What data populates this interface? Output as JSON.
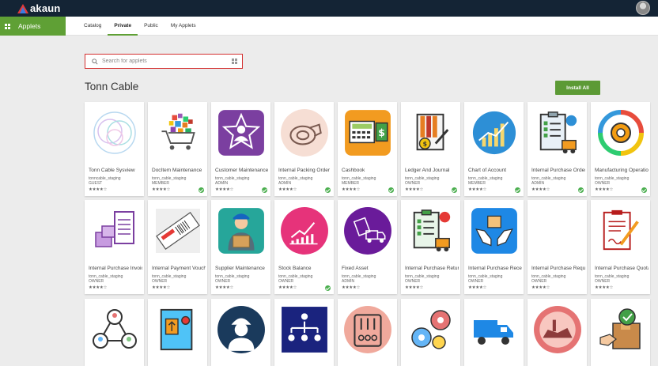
{
  "header": {
    "brand": "akaun"
  },
  "nav": {
    "module": "Applets",
    "tabs": [
      "Catalog",
      "Private",
      "Public",
      "My Applets"
    ],
    "active_tab": "Private"
  },
  "search": {
    "placeholder": "Search for applets"
  },
  "section": {
    "title": "Tonn Cable",
    "install_all": "Install All"
  },
  "colors": {
    "accent": "#5fa035",
    "header": "#142435",
    "search_border": "#d32f2f"
  },
  "apps_row1": [
    {
      "name": "Tonn Cable Sysview",
      "tenant": "tonncable_staging",
      "role": "GUEST",
      "rating": "★★★★☆",
      "installed": false,
      "icon": "network-circles-icon"
    },
    {
      "name": "DocItem Maintenance",
      "tenant": "tonn_cable_staging",
      "role": "MEMBER",
      "rating": "★★★★☆",
      "installed": true,
      "icon": "shopping-cart-icon"
    },
    {
      "name": "Customer Maintenance",
      "tenant": "tonn_cable_staging",
      "role": "ADMIN",
      "rating": "★★★★☆",
      "installed": true,
      "icon": "customer-star-icon"
    },
    {
      "name": "Internal Packing Order",
      "tenant": "tonn_cable_staging",
      "role": "ADMIN",
      "rating": "★★★★☆",
      "installed": true,
      "icon": "packing-tape-icon"
    },
    {
      "name": "Cashbook",
      "tenant": "tonn_cable_staging",
      "role": "MEMBER",
      "rating": "★★★★☆",
      "installed": true,
      "icon": "cashbook-icon"
    },
    {
      "name": "Ledger And Journal",
      "tenant": "tonn_cable_staging",
      "role": "OWNER",
      "rating": "★★★★☆",
      "installed": true,
      "icon": "ledger-icon"
    },
    {
      "name": "Chart of Account",
      "tenant": "tonn_cable_staging",
      "role": "MEMBER",
      "rating": "★★★★☆",
      "installed": true,
      "icon": "chart-icon"
    },
    {
      "name": "Internal Purchase Order",
      "tenant": "tonn_cable_staging",
      "role": "ADMIN",
      "rating": "★★★★☆",
      "installed": true,
      "icon": "clipboard-truck-icon"
    },
    {
      "name": "Manufacturing Operations",
      "tenant": "tonn_cable_staging",
      "role": "OWNER",
      "rating": "★★★★☆",
      "installed": true,
      "icon": "gear-cycle-icon"
    }
  ],
  "apps_row2": [
    {
      "name": "Internal Purchase Invoice",
      "tenant": "tonn_cable_staging",
      "role": "OWNER",
      "rating": "★★★★☆",
      "installed": false,
      "icon": "boxes-clipboard-icon"
    },
    {
      "name": "Internal Payment Voucher",
      "tenant": "tonn_cable_staging",
      "role": "OWNER",
      "rating": "★★★★☆",
      "installed": false,
      "icon": "voucher-icon"
    },
    {
      "name": "Supplier Maintenance",
      "tenant": "tonn_cable_staging",
      "role": "OWNER",
      "rating": "★★★★☆",
      "installed": false,
      "icon": "supplier-icon"
    },
    {
      "name": "Stock Balance",
      "tenant": "tonn_cable_staging",
      "role": "OWNER",
      "rating": "★★★★☆",
      "installed": true,
      "icon": "stock-chart-icon"
    },
    {
      "name": "Fixed Asset",
      "tenant": "tonn_cable_staging",
      "role": "ADMIN",
      "rating": "★★★★☆",
      "installed": false,
      "icon": "fixed-asset-icon"
    },
    {
      "name": "Internal Purchase Return",
      "tenant": "tonn_cable_staging",
      "role": "OWNER",
      "rating": "★★★★☆",
      "installed": false,
      "icon": "clipboard-truck-icon"
    },
    {
      "name": "Internal Purchase Receipt",
      "tenant": "tonn_cable_staging",
      "role": "OWNER",
      "rating": "★★★★☆",
      "installed": false,
      "icon": "hands-box-icon"
    },
    {
      "name": "Internal Purchase Requisition",
      "tenant": "tonn_cable_staging",
      "role": "OWNER",
      "rating": "★★★★☆",
      "installed": false,
      "icon": "blank-icon"
    },
    {
      "name": "Internal Purchase Quotation",
      "tenant": "tonn_cable_staging",
      "role": "OWNER",
      "rating": "★★★★☆",
      "installed": false,
      "icon": "contract-pen-icon"
    }
  ],
  "apps_row3_icons": [
    "people-network-icon",
    "document-upload-icon",
    "technician-icon",
    "org-chart-icon",
    "control-panel-icon",
    "gears-icon",
    "delivery-truck-icon",
    "factory-icon",
    "package-check-icon"
  ]
}
